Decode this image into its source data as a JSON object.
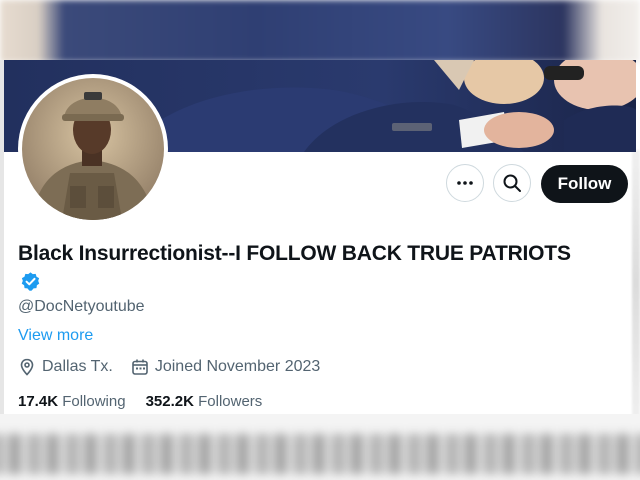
{
  "profile": {
    "display_name": "Black Insurrectionist--I FOLLOW BACK TRUE PATRIOTS",
    "handle": "@DocNetyoutube",
    "view_more": "View more",
    "location": "Dallas Tx.",
    "joined": "Joined November 2023",
    "following_count": "17.4K",
    "following_label": "Following",
    "followers_count": "352.2K",
    "followers_label": "Followers"
  },
  "actions": {
    "follow_label": "Follow",
    "more_icon": "more-horizontal-icon",
    "search_icon": "search-icon"
  },
  "colors": {
    "accent": "#1d9bf0",
    "text_primary": "#0f1419",
    "text_secondary": "#536471",
    "follow_bg": "#0f1419"
  }
}
